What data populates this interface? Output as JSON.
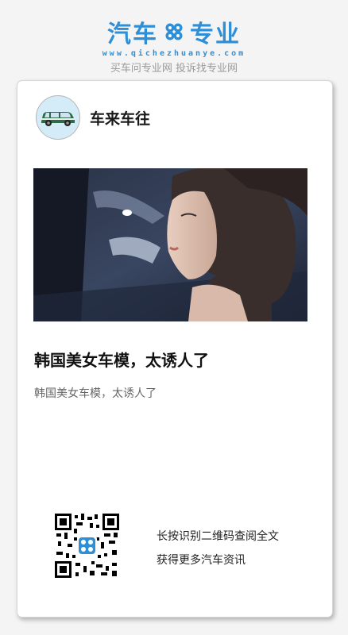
{
  "brand": {
    "name_left": "汽车",
    "name_right": "专业",
    "domain": "www.qichezhuanye.com",
    "tagline": "买车问专业网 投诉找专业网",
    "accent": "#2f8fd6"
  },
  "author": {
    "name": "车来车往",
    "avatar_icon": "car-icon"
  },
  "article": {
    "title": "韩国美女车模，太诱人了",
    "summary": "韩国美女车模，太诱人了"
  },
  "qr": {
    "icon": "qr-code-icon",
    "line1": "长按识别二维码查阅全文",
    "line2": "获得更多汽车资讯"
  }
}
